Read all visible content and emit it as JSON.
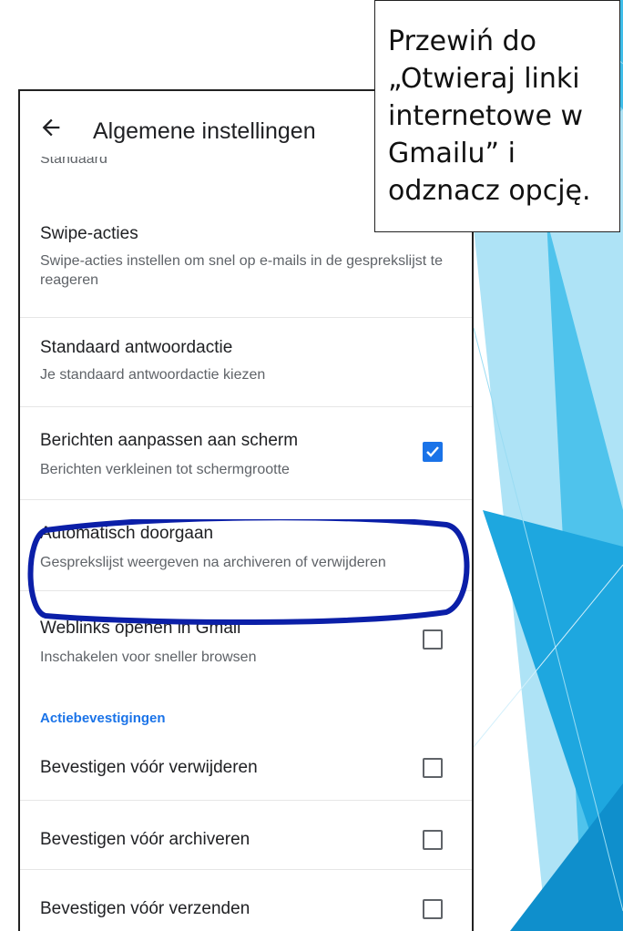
{
  "callout": {
    "text": "Przewiń do\n„Otwieraj linki\ninternetowe w\nGmailu” i\nodznacz opcję."
  },
  "appbar": {
    "title": "Algemene instellingen",
    "back_icon": "arrow-left-icon"
  },
  "cut_subtitle": "Standaard",
  "settings": [
    {
      "title": "Swipe-acties",
      "subtitle": "Swipe-acties instellen om snel op e-mails in de gesprekslijst te reageren"
    },
    {
      "title": "Standaard antwoordactie",
      "subtitle": "Je standaard antwoordactie kiezen"
    },
    {
      "title": "Berichten aanpassen aan scherm",
      "subtitle": "Berichten verkleinen tot schermgrootte",
      "checked": true
    },
    {
      "title": "Automatisch doorgaan",
      "subtitle": "Gesprekslijst weergeven na archiveren of verwijderen"
    },
    {
      "title": "Weblinks openen in Gmail",
      "subtitle": "Inschakelen voor sneller browsen",
      "checked": false
    }
  ],
  "section": {
    "label": "Actiebevestigingen",
    "items": [
      {
        "title": "Bevestigen vóór verwijderen",
        "checked": false
      },
      {
        "title": "Bevestigen vóór archiveren",
        "checked": false
      },
      {
        "title": "Bevestigen vóór verzenden",
        "checked": false
      }
    ]
  },
  "colors": {
    "accent": "#1a73e8",
    "annotation": "#0b1fa8",
    "slide_blue": "#2bb0e6"
  }
}
